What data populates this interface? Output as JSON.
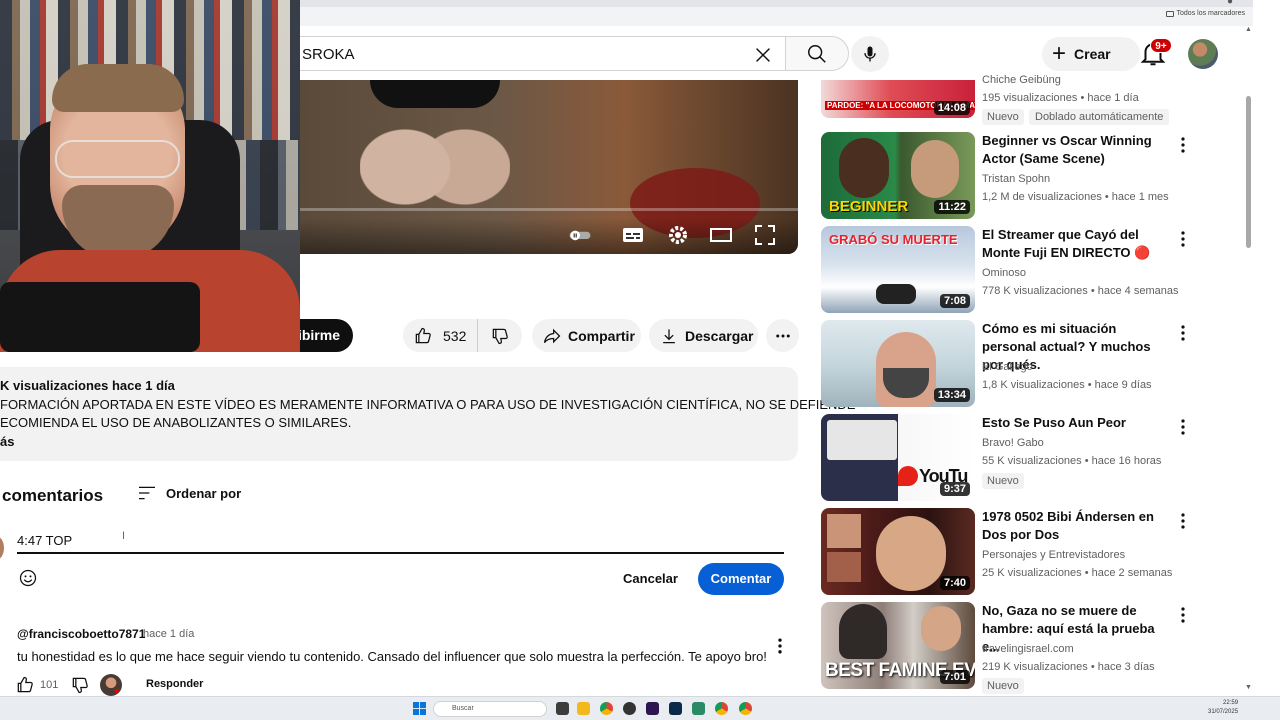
{
  "browser": {
    "bookmarks_folder_label": "Todos los marcadores"
  },
  "masthead": {
    "search_value": "SROKA",
    "create_label": "Crear",
    "notifications_count": "9+"
  },
  "video": {
    "like_count": "532",
    "subscribe_label": "ribirme",
    "share_label": "Compartir",
    "download_label": "Descargar"
  },
  "description": {
    "views_line": "K visualizaciones  hace 1 día",
    "line1": "FORMACIÓN APORTADA EN ESTE VÍDEO ES MERAMENTE INFORMATIVA O PARA USO DE INVESTIGACIÓN CIENTÍFICA, NO SE DEFIENDE",
    "line2": "ECOMIENDA EL USO DE ANABOLIZANTES O SIMILARES.",
    "more_label": "ás"
  },
  "comments": {
    "title": "comentarios",
    "sort_label": "Ordenar por",
    "composer_value": "4:47 TOP",
    "cancel_label": "Cancelar",
    "submit_label": "Comentar",
    "items": [
      {
        "author": "@franciscoboetto7871",
        "time": "hace 1 día",
        "text": "tu honestidad es lo que me hace seguir viendo tu contenido. Cansado del influencer que solo muestra la perfección. Te apoyo bro!",
        "likes": "101",
        "reply_label": "Responder"
      }
    ]
  },
  "recommendations": [
    {
      "title_line2": "Chiche Geibüng",
      "duration": "14:08",
      "meta": "195 visualizaciones • hace 1 día",
      "badge": "Nuevo",
      "badge2": "Doblado automáticamente",
      "thumb_text": "PARDOE: \"A LA LOCOMOTORA LA MATO"
    },
    {
      "title": "Beginner vs Oscar Winning Actor (Same Scene)",
      "channel": "Tristan Spohn",
      "meta": "1,2 M de visualizaciones • hace 1 mes",
      "duration": "11:22",
      "thumb_text": "BEGINNER"
    },
    {
      "title": "El Streamer que Cayó del Monte Fuji EN DIRECTO 🔴",
      "channel": "Ominoso",
      "meta": "778 K visualizaciones • hace 4 semanas",
      "duration": "7:08",
      "thumb_text": "GRABÓ SU MUERTE"
    },
    {
      "title": "Cómo es mi situación personal actual? Y muchos por qués.",
      "channel": "El Gallego",
      "meta": "1,8 K visualizaciones • hace 9 días",
      "duration": "13:34"
    },
    {
      "title": "Esto Se Puso Aun Peor",
      "channel": "Bravo! Gabo",
      "meta": "55 K visualizaciones • hace 16 horas",
      "duration": "9:37",
      "badge": "Nuevo",
      "thumb_text": "YouTu"
    },
    {
      "title": "1978 0502 Bibi Ándersen en Dos por Dos",
      "channel": "Personajes y Entrevistadores",
      "meta": "25 K visualizaciones • hace 2 semanas",
      "duration": "7:40"
    },
    {
      "title": "No, Gaza no se muere de hambre: aquí está la prueba e...",
      "channel": "travelingisrael.com",
      "meta": "219 K visualizaciones • hace 3 días",
      "duration": "7:01",
      "badge": "Nuevo",
      "thumb_text": "BEST FAMINE EVER"
    }
  ],
  "taskbar": {
    "search_placeholder": "Buscar",
    "time": "22:59",
    "date": "31/07/2025"
  },
  "colors": {
    "accent_blue": "#065fd4",
    "badge_red": "#cc0000"
  }
}
